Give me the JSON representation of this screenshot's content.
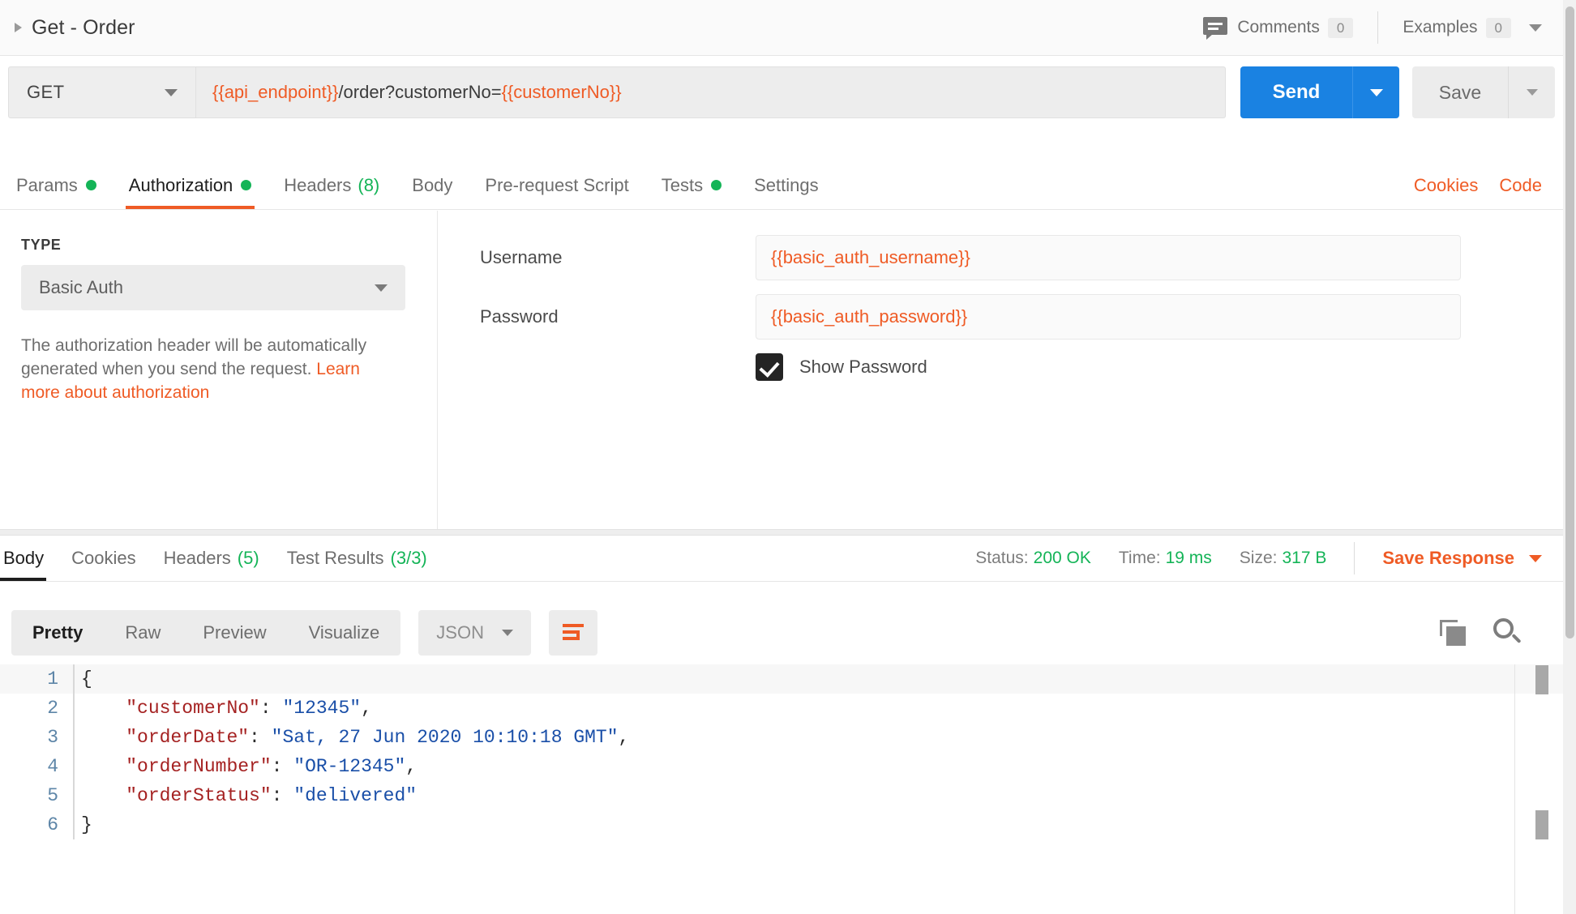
{
  "header": {
    "expand_icon": "caret-right-icon",
    "request_title": "Get - Order",
    "comments_icon": "comment-icon",
    "comments_label": "Comments",
    "comments_count": "0",
    "examples_label": "Examples",
    "examples_count": "0",
    "examples_caret": "chevron-down-icon"
  },
  "urlbar": {
    "method": "GET",
    "url_var_1": "{{api_endpoint}}",
    "url_plain": "/order?customerNo=",
    "url_var_2": "{{customerNo}}",
    "send_label": "Send",
    "save_label": "Save"
  },
  "request_tabs": {
    "items": [
      {
        "label": "Params",
        "indicator": "dot",
        "active": false
      },
      {
        "label": "Authorization",
        "indicator": "dot",
        "active": true
      },
      {
        "label": "Headers",
        "indicator": "count",
        "count": "(8)",
        "active": false
      },
      {
        "label": "Body",
        "indicator": "none",
        "active": false
      },
      {
        "label": "Pre-request Script",
        "indicator": "none",
        "active": false
      },
      {
        "label": "Tests",
        "indicator": "dot",
        "active": false
      },
      {
        "label": "Settings",
        "indicator": "none",
        "active": false
      }
    ],
    "cookies_label": "Cookies",
    "code_label": "Code"
  },
  "auth": {
    "type_label": "TYPE",
    "type_value": "Basic Auth",
    "description_prefix": "The authorization header will be automatically generated when you send the request. ",
    "description_link": "Learn more about authorization",
    "username_label": "Username",
    "username_value": "{{basic_auth_username}}",
    "username_placeholder": "Username",
    "password_label": "Password",
    "password_value": "{{basic_auth_password}}",
    "password_placeholder": "Password",
    "show_password_label": "Show Password",
    "show_password_checked": true
  },
  "response_tabs": {
    "items": [
      {
        "label": "Body",
        "count": "",
        "active": true
      },
      {
        "label": "Cookies",
        "count": "",
        "active": false
      },
      {
        "label": "Headers",
        "count": "(5)",
        "active": false
      },
      {
        "label": "Test Results",
        "count": "(3/3)",
        "active": false
      }
    ],
    "status_label": "Status:",
    "status_value": "200 OK",
    "time_label": "Time:",
    "time_value": "19 ms",
    "size_label": "Size:",
    "size_value": "317 B",
    "save_response_label": "Save Response"
  },
  "body_toolbar": {
    "views": [
      {
        "label": "Pretty",
        "active": true
      },
      {
        "label": "Raw",
        "active": false
      },
      {
        "label": "Preview",
        "active": false
      },
      {
        "label": "Visualize",
        "active": false
      }
    ],
    "format": "JSON",
    "beautify_icon": "wrap-lines-icon",
    "copy_icon": "copy-icon",
    "search_icon": "search-icon"
  },
  "response_body": {
    "language": "json",
    "lines": [
      {
        "num": "1",
        "segments": [
          {
            "t": "{",
            "c": "jpunct"
          }
        ]
      },
      {
        "num": "2",
        "segments": [
          {
            "t": "    ",
            "c": "jpunct"
          },
          {
            "t": "\"customerNo\"",
            "c": "jkey"
          },
          {
            "t": ": ",
            "c": "jpunct"
          },
          {
            "t": "\"12345\"",
            "c": "jstr"
          },
          {
            "t": ",",
            "c": "jpunct"
          }
        ]
      },
      {
        "num": "3",
        "segments": [
          {
            "t": "    ",
            "c": "jpunct"
          },
          {
            "t": "\"orderDate\"",
            "c": "jkey"
          },
          {
            "t": ": ",
            "c": "jpunct"
          },
          {
            "t": "\"Sat, 27 Jun 2020 10:10:18 GMT\"",
            "c": "jstr"
          },
          {
            "t": ",",
            "c": "jpunct"
          }
        ]
      },
      {
        "num": "4",
        "segments": [
          {
            "t": "    ",
            "c": "jpunct"
          },
          {
            "t": "\"orderNumber\"",
            "c": "jkey"
          },
          {
            "t": ": ",
            "c": "jpunct"
          },
          {
            "t": "\"OR-12345\"",
            "c": "jstr"
          },
          {
            "t": ",",
            "c": "jpunct"
          }
        ]
      },
      {
        "num": "5",
        "segments": [
          {
            "t": "    ",
            "c": "jpunct"
          },
          {
            "t": "\"orderStatus\"",
            "c": "jkey"
          },
          {
            "t": ": ",
            "c": "jpunct"
          },
          {
            "t": "\"delivered\"",
            "c": "jstr"
          }
        ]
      },
      {
        "num": "6",
        "segments": [
          {
            "t": "}",
            "c": "jpunct"
          }
        ]
      }
    ]
  },
  "colors": {
    "accent_orange": "#ef5b25",
    "send_blue": "#1a82e2",
    "status_green": "#14b457",
    "json_key": "#a52222",
    "json_string": "#1a4fa8",
    "gutter_blue": "#5e86a8"
  }
}
